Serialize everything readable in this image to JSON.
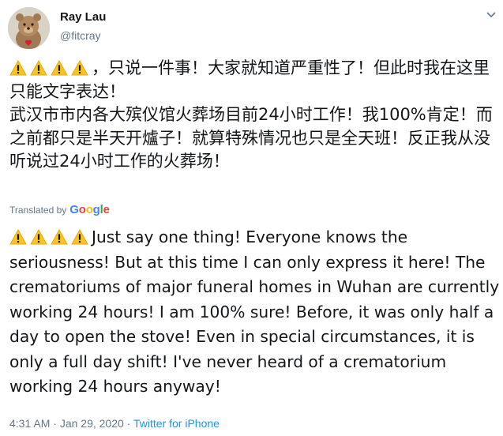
{
  "author": {
    "display_name": "Ray Lau",
    "handle": "@fitcray"
  },
  "tweet": {
    "emoji": "⚠️⚠️⚠️⚠️",
    "text": "，只说一件事！大家就知道严重性了！但此时我在这里只能文字表达！\n武汉市市内各大殡仪馆火葬场目前24小时工作！我100%肯定！而之前都只是半天开爐子！就算特殊情况也只是全天班！反正我从没听说过24小时工作的火葬场！"
  },
  "translation": {
    "label": "Translated by",
    "provider": "Google",
    "text": "Just say one thing! Everyone knows the seriousness! But at this time I can only express it here! The crematoriums of major funeral homes in Wuhan are currently working 24 hours! I am 100% sure! Before, it was only half a day to open the stove! Even in special circumstances, it is only a full day shift! I've never heard of a crematorium working 24 hours anyway!"
  },
  "meta": {
    "time": "4:31 AM",
    "separator": " · ",
    "date": "Jan 29, 2020",
    "source": "Twitter for iPhone"
  },
  "colors": {
    "warning": "#f7c325",
    "link": "#1b95e0",
    "secondary_text": "#657786"
  }
}
